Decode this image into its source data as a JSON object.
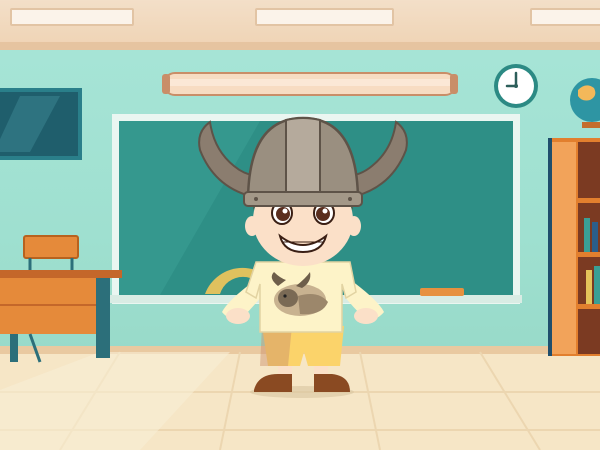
{
  "scene": {
    "name": "classroom",
    "colors": {
      "wall": "#a6e4d6",
      "chalkboard": "#2e8f86",
      "chalkboard_frame": "#eaf6f1",
      "floor": "#f6e6c6",
      "desk": "#e58a3a",
      "bookcase": "#e27f2e",
      "clock_face": "#ffffff"
    },
    "clock": {
      "hour": 9,
      "minute": 0
    }
  },
  "character": {
    "name": "sprite-student-viking-helmet",
    "helmet_color": "#9a8f80",
    "horn_color": "#8b7d6f",
    "shirt_color": "#fdf3c8",
    "shorts_color": "#fbd36a",
    "shoe_color": "#8a4a22",
    "shirt_print": "gnu-icon"
  }
}
